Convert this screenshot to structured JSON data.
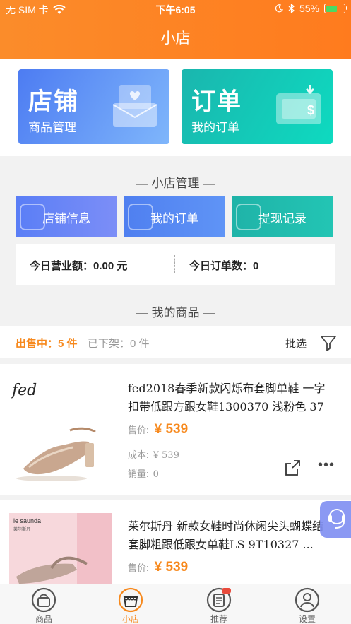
{
  "status_bar": {
    "carrier": "无 SIM 卡",
    "time": "下午6:05",
    "battery": "55%"
  },
  "nav": {
    "title": "小店"
  },
  "cards": [
    {
      "title": "店铺",
      "subtitle": "商品管理"
    },
    {
      "title": "订单",
      "subtitle": "我的订单"
    }
  ],
  "management": {
    "title": "— 小店管理 —",
    "buttons": [
      "店铺信息",
      "我的订单",
      "提现记录"
    ],
    "today_revenue": "今日营业额：0.00 元",
    "today_orders": "今日订单数：0"
  },
  "goods": {
    "title": "— 我的商品 —",
    "on_sale": "出售中：5 件",
    "off_shelf": "已下架：0 件",
    "filter_label": "批选"
  },
  "products": [
    {
      "brand_logo": "fed",
      "title": "fed2018春季新款闪烁布套脚单鞋 一字扣带低跟方跟女鞋1300370 浅粉色 37",
      "price_label": "售价:",
      "price": "¥ 539",
      "cost_label": "成本:",
      "cost": "¥ 539",
      "sales_label": "销量:",
      "sales": "0"
    },
    {
      "brand_logo": "le saunda",
      "brand_logo_cn": "莱尔斯丹",
      "title": "莱尔斯丹 新款女鞋时尚休闲尖头蝴蝶结套脚粗跟低跟女单鞋LS 9T10327 ...",
      "price_label": "售价:",
      "price": "¥ 539"
    }
  ],
  "tabs": [
    {
      "label": "商品",
      "icon": "shopping-bag-icon"
    },
    {
      "label": "小店",
      "icon": "shop-icon",
      "active": true
    },
    {
      "label": "推荐",
      "icon": "recommend-icon"
    },
    {
      "label": "设置",
      "icon": "user-icon"
    }
  ],
  "colors": {
    "accent": "#f7891d",
    "header": "#fb8c2a"
  }
}
